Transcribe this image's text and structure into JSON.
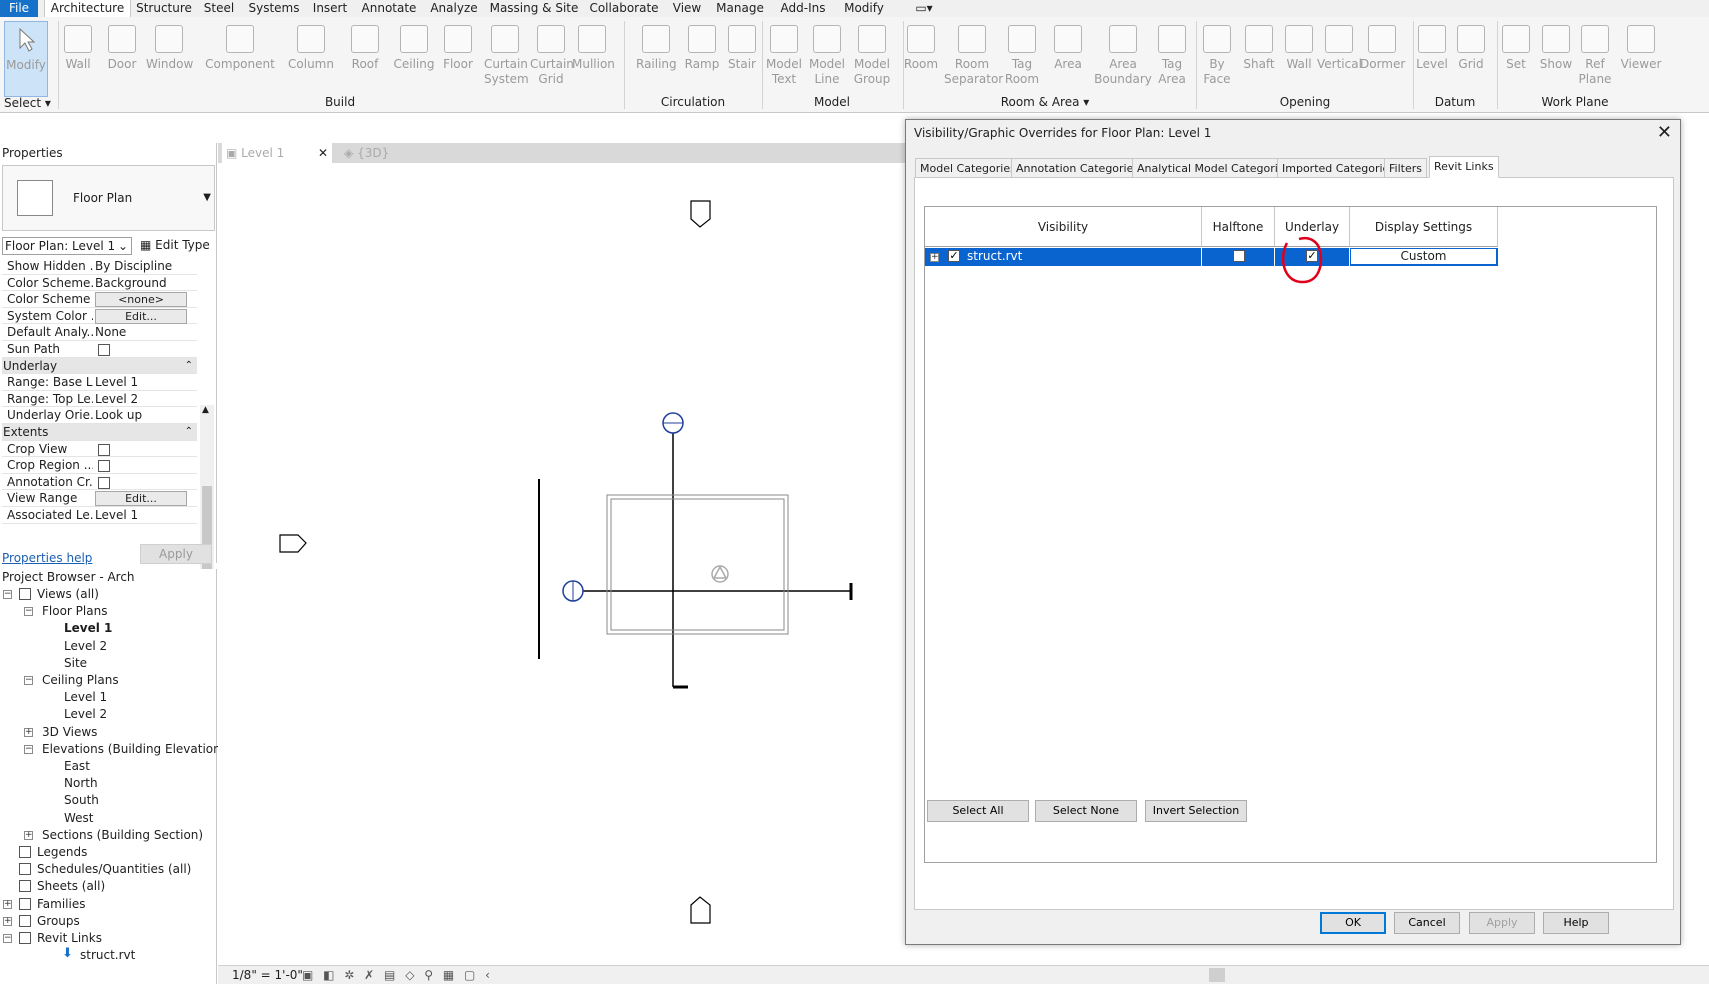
{
  "menu": {
    "tabs": [
      "File",
      "Architecture",
      "Structure",
      "Steel",
      "Systems",
      "Insert",
      "Annotate",
      "Analyze",
      "Massing & Site",
      "Collaborate",
      "View",
      "Manage",
      "Add-Ins",
      "Modify"
    ]
  },
  "ribbon": {
    "select_label": "Select",
    "modify": "Modify",
    "buttons": [
      {
        "line1": "Wall",
        "line2": ""
      },
      {
        "line1": "Door",
        "line2": ""
      },
      {
        "line1": "Window",
        "line2": ""
      },
      {
        "line1": "Component",
        "line2": ""
      },
      {
        "line1": "Column",
        "line2": ""
      },
      {
        "line1": "Roof",
        "line2": ""
      },
      {
        "line1": "Ceiling",
        "line2": ""
      },
      {
        "line1": "Floor",
        "line2": ""
      },
      {
        "line1": "Curtain",
        "line2": "System"
      },
      {
        "line1": "Curtain",
        "line2": "Grid"
      },
      {
        "line1": "Mullion",
        "line2": ""
      },
      {
        "line1": "Railing",
        "line2": ""
      },
      {
        "line1": "Ramp",
        "line2": ""
      },
      {
        "line1": "Stair",
        "line2": ""
      },
      {
        "line1": "Model",
        "line2": "Text"
      },
      {
        "line1": "Model",
        "line2": "Line"
      },
      {
        "line1": "Model",
        "line2": "Group"
      },
      {
        "line1": "Room",
        "line2": ""
      },
      {
        "line1": "Room",
        "line2": "Separator"
      },
      {
        "line1": "Tag",
        "line2": "Room"
      },
      {
        "line1": "Area",
        "line2": ""
      },
      {
        "line1": "Area",
        "line2": "Boundary"
      },
      {
        "line1": "Tag",
        "line2": "Area"
      },
      {
        "line1": "By",
        "line2": "Face"
      },
      {
        "line1": "Shaft",
        "line2": ""
      },
      {
        "line1": "Wall",
        "line2": ""
      },
      {
        "line1": "Vertical",
        "line2": ""
      },
      {
        "line1": "Dormer",
        "line2": ""
      },
      {
        "line1": "Level",
        "line2": ""
      },
      {
        "line1": "Grid",
        "line2": ""
      },
      {
        "line1": "Set",
        "line2": ""
      },
      {
        "line1": "Show",
        "line2": ""
      },
      {
        "line1": "Ref",
        "line2": "Plane"
      },
      {
        "line1": "Viewer",
        "line2": ""
      }
    ],
    "panels": [
      "Build",
      "Circulation",
      "Model",
      "Room & Area",
      "Opening",
      "Datum",
      "Work Plane"
    ]
  },
  "properties": {
    "title": "Properties",
    "type_name": "Floor Plan",
    "instance": "Floor Plan: Level 1",
    "edit_type": "Edit Type",
    "rows": [
      {
        "key": "Show Hidden ...",
        "value": "By Discipline",
        "kind": "text"
      },
      {
        "key": "Color Scheme...",
        "value": "Background",
        "kind": "text"
      },
      {
        "key": "Color Scheme",
        "value": "<none>",
        "kind": "button"
      },
      {
        "key": "System Color ...",
        "value": "Edit...",
        "kind": "button"
      },
      {
        "key": "Default Analy...",
        "value": "None",
        "kind": "text"
      },
      {
        "key": "Sun Path",
        "value": "",
        "kind": "check"
      },
      {
        "key": "Underlay",
        "value": "",
        "kind": "group"
      },
      {
        "key": "Range: Base L...",
        "value": "Level 1",
        "kind": "text"
      },
      {
        "key": "Range: Top Le...",
        "value": "Level 2",
        "kind": "text"
      },
      {
        "key": "Underlay Orie...",
        "value": "Look up",
        "kind": "text"
      },
      {
        "key": "Extents",
        "value": "",
        "kind": "group"
      },
      {
        "key": "Crop View",
        "value": "",
        "kind": "check"
      },
      {
        "key": "Crop Region ...",
        "value": "",
        "kind": "check"
      },
      {
        "key": "Annotation Cr...",
        "value": "",
        "kind": "check"
      },
      {
        "key": "View Range",
        "value": "Edit...",
        "kind": "button"
      },
      {
        "key": "Associated Le...",
        "value": "Level 1",
        "kind": "text"
      }
    ],
    "help_link": "Properties help",
    "apply": "Apply"
  },
  "browser": {
    "title": "Project Browser - Arch",
    "nodes": [
      {
        "label": "Views (all)",
        "indent": 0,
        "exp": "−",
        "icon": true,
        "bold": false
      },
      {
        "label": "Floor Plans",
        "indent": 1,
        "exp": "−",
        "icon": false,
        "bold": false
      },
      {
        "label": "Level 1",
        "indent": 2,
        "exp": "",
        "icon": false,
        "bold": true
      },
      {
        "label": "Level 2",
        "indent": 2,
        "exp": "",
        "icon": false,
        "bold": false
      },
      {
        "label": "Site",
        "indent": 2,
        "exp": "",
        "icon": false,
        "bold": false
      },
      {
        "label": "Ceiling Plans",
        "indent": 1,
        "exp": "−",
        "icon": false,
        "bold": false
      },
      {
        "label": "Level 1",
        "indent": 2,
        "exp": "",
        "icon": false,
        "bold": false
      },
      {
        "label": "Level 2",
        "indent": 2,
        "exp": "",
        "icon": false,
        "bold": false
      },
      {
        "label": "3D Views",
        "indent": 1,
        "exp": "+",
        "icon": false,
        "bold": false
      },
      {
        "label": "Elevations (Building Elevation)",
        "indent": 1,
        "exp": "−",
        "icon": false,
        "bold": false
      },
      {
        "label": "East",
        "indent": 2,
        "exp": "",
        "icon": false,
        "bold": false
      },
      {
        "label": "North",
        "indent": 2,
        "exp": "",
        "icon": false,
        "bold": false
      },
      {
        "label": "South",
        "indent": 2,
        "exp": "",
        "icon": false,
        "bold": false
      },
      {
        "label": "West",
        "indent": 2,
        "exp": "",
        "icon": false,
        "bold": false
      },
      {
        "label": "Sections (Building Section)",
        "indent": 1,
        "exp": "+",
        "icon": false,
        "bold": false
      },
      {
        "label": "Legends",
        "indent": 0,
        "exp": "",
        "icon": true,
        "bold": false
      },
      {
        "label": "Schedules/Quantities (all)",
        "indent": 0,
        "exp": "",
        "icon": true,
        "bold": false
      },
      {
        "label": "Sheets (all)",
        "indent": 0,
        "exp": "",
        "icon": true,
        "bold": false
      },
      {
        "label": "Families",
        "indent": 0,
        "exp": "+",
        "icon": true,
        "bold": false
      },
      {
        "label": "Groups",
        "indent": 0,
        "exp": "+",
        "icon": true,
        "bold": false
      },
      {
        "label": "Revit Links",
        "indent": 0,
        "exp": "−",
        "icon": true,
        "bold": false
      },
      {
        "label": "struct.rvt",
        "indent": 2,
        "exp": "",
        "icon": false,
        "bold": false
      }
    ]
  },
  "view_tabs": {
    "level1": "Level 1",
    "threed": "{3D}"
  },
  "status": {
    "scale": "1/8\" = 1'-0\""
  },
  "dialog": {
    "title": "Visibility/Graphic Overrides for Floor Plan: Level 1",
    "close": "✕",
    "tabs": [
      "Model Categories",
      "Annotation Categories",
      "Analytical Model Categories",
      "Imported Categories",
      "Filters",
      "Revit Links"
    ],
    "active_tab": "Revit Links",
    "columns": [
      "Visibility",
      "Halftone",
      "Underlay",
      "Display Settings"
    ],
    "row": {
      "name": "struct.rvt",
      "visible": true,
      "halftone": false,
      "underlay": true,
      "display": "Custom"
    },
    "select_all": "Select All",
    "select_none": "Select None",
    "invert": "Invert Selection",
    "ok": "OK",
    "cancel": "Cancel",
    "apply": "Apply",
    "help": "Help"
  },
  "colors": {
    "accent": "#0a64d0",
    "file_tab": "#1672c9",
    "annotation": "#e0001b"
  }
}
